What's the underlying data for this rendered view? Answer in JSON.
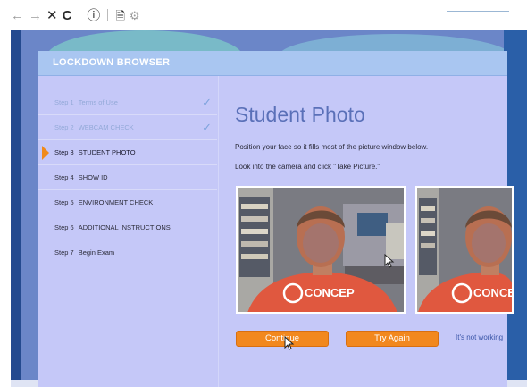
{
  "browser": {
    "back_glyph": "←",
    "forward_glyph": "→",
    "close_glyph": "✕",
    "reload_glyph": "C",
    "info_glyph": "ⓘ",
    "page_glyph": "🗎",
    "settings_glyph": "⚙"
  },
  "app": {
    "title": "LOCKDOWN BROWSER",
    "steps": [
      {
        "prefix": "Step 1",
        "label": "Terms of Use",
        "status": "done"
      },
      {
        "prefix": "Step 2",
        "label": "WEBCAM CHECK",
        "status": "done"
      },
      {
        "prefix": "Step 3",
        "label": "STUDENT PHOTO",
        "status": "active"
      },
      {
        "prefix": "Step 4",
        "label": "SHOW ID",
        "status": "pending"
      },
      {
        "prefix": "Step 5",
        "label": "ENVIRONMENT CHECK",
        "status": "pending"
      },
      {
        "prefix": "Step 6",
        "label": "ADDITIONAL INSTRUCTIONS",
        "status": "pending"
      },
      {
        "prefix": "Step 7",
        "label": "Begin Exam",
        "status": "pending"
      }
    ],
    "check_glyph": "✓",
    "main": {
      "title": "Student Photo",
      "instruction_1": "Position your face so it fills most of the picture window below.",
      "instruction_2": "Look into the camera and click \"Take Picture.\""
    },
    "buttons": {
      "continue": "Continue",
      "try_again": "Try Again",
      "not_working_link": "It's not working"
    },
    "photo_shirt_text": "CONCEP"
  },
  "colors": {
    "accent_orange": "#f2881e",
    "panel_bg": "#c5c8f8",
    "title_blue": "#5a70b8",
    "header_bg": "#a9c6f1"
  }
}
